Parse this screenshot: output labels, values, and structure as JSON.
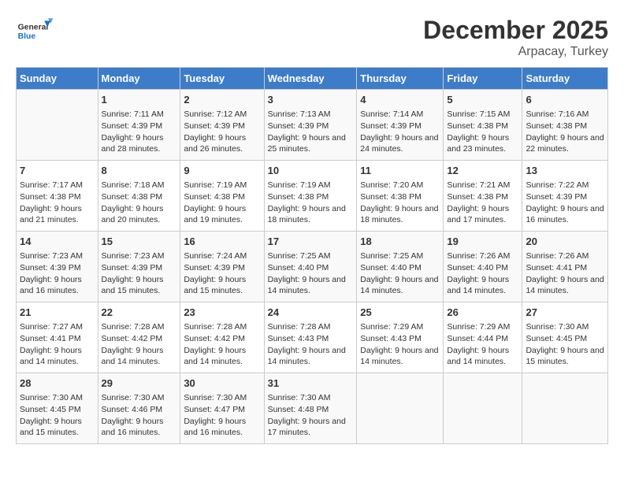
{
  "header": {
    "logo_general": "General",
    "logo_blue": "Blue",
    "title": "December 2025",
    "subtitle": "Arpacay, Turkey"
  },
  "weekdays": [
    "Sunday",
    "Monday",
    "Tuesday",
    "Wednesday",
    "Thursday",
    "Friday",
    "Saturday"
  ],
  "weeks": [
    [
      {
        "day": "",
        "sunrise": "",
        "sunset": "",
        "daylight": ""
      },
      {
        "day": "1",
        "sunrise": "Sunrise: 7:11 AM",
        "sunset": "Sunset: 4:39 PM",
        "daylight": "Daylight: 9 hours and 28 minutes."
      },
      {
        "day": "2",
        "sunrise": "Sunrise: 7:12 AM",
        "sunset": "Sunset: 4:39 PM",
        "daylight": "Daylight: 9 hours and 26 minutes."
      },
      {
        "day": "3",
        "sunrise": "Sunrise: 7:13 AM",
        "sunset": "Sunset: 4:39 PM",
        "daylight": "Daylight: 9 hours and 25 minutes."
      },
      {
        "day": "4",
        "sunrise": "Sunrise: 7:14 AM",
        "sunset": "Sunset: 4:39 PM",
        "daylight": "Daylight: 9 hours and 24 minutes."
      },
      {
        "day": "5",
        "sunrise": "Sunrise: 7:15 AM",
        "sunset": "Sunset: 4:38 PM",
        "daylight": "Daylight: 9 hours and 23 minutes."
      },
      {
        "day": "6",
        "sunrise": "Sunrise: 7:16 AM",
        "sunset": "Sunset: 4:38 PM",
        "daylight": "Daylight: 9 hours and 22 minutes."
      }
    ],
    [
      {
        "day": "7",
        "sunrise": "Sunrise: 7:17 AM",
        "sunset": "Sunset: 4:38 PM",
        "daylight": "Daylight: 9 hours and 21 minutes."
      },
      {
        "day": "8",
        "sunrise": "Sunrise: 7:18 AM",
        "sunset": "Sunset: 4:38 PM",
        "daylight": "Daylight: 9 hours and 20 minutes."
      },
      {
        "day": "9",
        "sunrise": "Sunrise: 7:19 AM",
        "sunset": "Sunset: 4:38 PM",
        "daylight": "Daylight: 9 hours and 19 minutes."
      },
      {
        "day": "10",
        "sunrise": "Sunrise: 7:19 AM",
        "sunset": "Sunset: 4:38 PM",
        "daylight": "Daylight: 9 hours and 18 minutes."
      },
      {
        "day": "11",
        "sunrise": "Sunrise: 7:20 AM",
        "sunset": "Sunset: 4:38 PM",
        "daylight": "Daylight: 9 hours and 18 minutes."
      },
      {
        "day": "12",
        "sunrise": "Sunrise: 7:21 AM",
        "sunset": "Sunset: 4:38 PM",
        "daylight": "Daylight: 9 hours and 17 minutes."
      },
      {
        "day": "13",
        "sunrise": "Sunrise: 7:22 AM",
        "sunset": "Sunset: 4:39 PM",
        "daylight": "Daylight: 9 hours and 16 minutes."
      }
    ],
    [
      {
        "day": "14",
        "sunrise": "Sunrise: 7:23 AM",
        "sunset": "Sunset: 4:39 PM",
        "daylight": "Daylight: 9 hours and 16 minutes."
      },
      {
        "day": "15",
        "sunrise": "Sunrise: 7:23 AM",
        "sunset": "Sunset: 4:39 PM",
        "daylight": "Daylight: 9 hours and 15 minutes."
      },
      {
        "day": "16",
        "sunrise": "Sunrise: 7:24 AM",
        "sunset": "Sunset: 4:39 PM",
        "daylight": "Daylight: 9 hours and 15 minutes."
      },
      {
        "day": "17",
        "sunrise": "Sunrise: 7:25 AM",
        "sunset": "Sunset: 4:40 PM",
        "daylight": "Daylight: 9 hours and 14 minutes."
      },
      {
        "day": "18",
        "sunrise": "Sunrise: 7:25 AM",
        "sunset": "Sunset: 4:40 PM",
        "daylight": "Daylight: 9 hours and 14 minutes."
      },
      {
        "day": "19",
        "sunrise": "Sunrise: 7:26 AM",
        "sunset": "Sunset: 4:40 PM",
        "daylight": "Daylight: 9 hours and 14 minutes."
      },
      {
        "day": "20",
        "sunrise": "Sunrise: 7:26 AM",
        "sunset": "Sunset: 4:41 PM",
        "daylight": "Daylight: 9 hours and 14 minutes."
      }
    ],
    [
      {
        "day": "21",
        "sunrise": "Sunrise: 7:27 AM",
        "sunset": "Sunset: 4:41 PM",
        "daylight": "Daylight: 9 hours and 14 minutes."
      },
      {
        "day": "22",
        "sunrise": "Sunrise: 7:28 AM",
        "sunset": "Sunset: 4:42 PM",
        "daylight": "Daylight: 9 hours and 14 minutes."
      },
      {
        "day": "23",
        "sunrise": "Sunrise: 7:28 AM",
        "sunset": "Sunset: 4:42 PM",
        "daylight": "Daylight: 9 hours and 14 minutes."
      },
      {
        "day": "24",
        "sunrise": "Sunrise: 7:28 AM",
        "sunset": "Sunset: 4:43 PM",
        "daylight": "Daylight: 9 hours and 14 minutes."
      },
      {
        "day": "25",
        "sunrise": "Sunrise: 7:29 AM",
        "sunset": "Sunset: 4:43 PM",
        "daylight": "Daylight: 9 hours and 14 minutes."
      },
      {
        "day": "26",
        "sunrise": "Sunrise: 7:29 AM",
        "sunset": "Sunset: 4:44 PM",
        "daylight": "Daylight: 9 hours and 14 minutes."
      },
      {
        "day": "27",
        "sunrise": "Sunrise: 7:30 AM",
        "sunset": "Sunset: 4:45 PM",
        "daylight": "Daylight: 9 hours and 15 minutes."
      }
    ],
    [
      {
        "day": "28",
        "sunrise": "Sunrise: 7:30 AM",
        "sunset": "Sunset: 4:45 PM",
        "daylight": "Daylight: 9 hours and 15 minutes."
      },
      {
        "day": "29",
        "sunrise": "Sunrise: 7:30 AM",
        "sunset": "Sunset: 4:46 PM",
        "daylight": "Daylight: 9 hours and 16 minutes."
      },
      {
        "day": "30",
        "sunrise": "Sunrise: 7:30 AM",
        "sunset": "Sunset: 4:47 PM",
        "daylight": "Daylight: 9 hours and 16 minutes."
      },
      {
        "day": "31",
        "sunrise": "Sunrise: 7:30 AM",
        "sunset": "Sunset: 4:48 PM",
        "daylight": "Daylight: 9 hours and 17 minutes."
      },
      {
        "day": "",
        "sunrise": "",
        "sunset": "",
        "daylight": ""
      },
      {
        "day": "",
        "sunrise": "",
        "sunset": "",
        "daylight": ""
      },
      {
        "day": "",
        "sunrise": "",
        "sunset": "",
        "daylight": ""
      }
    ]
  ]
}
